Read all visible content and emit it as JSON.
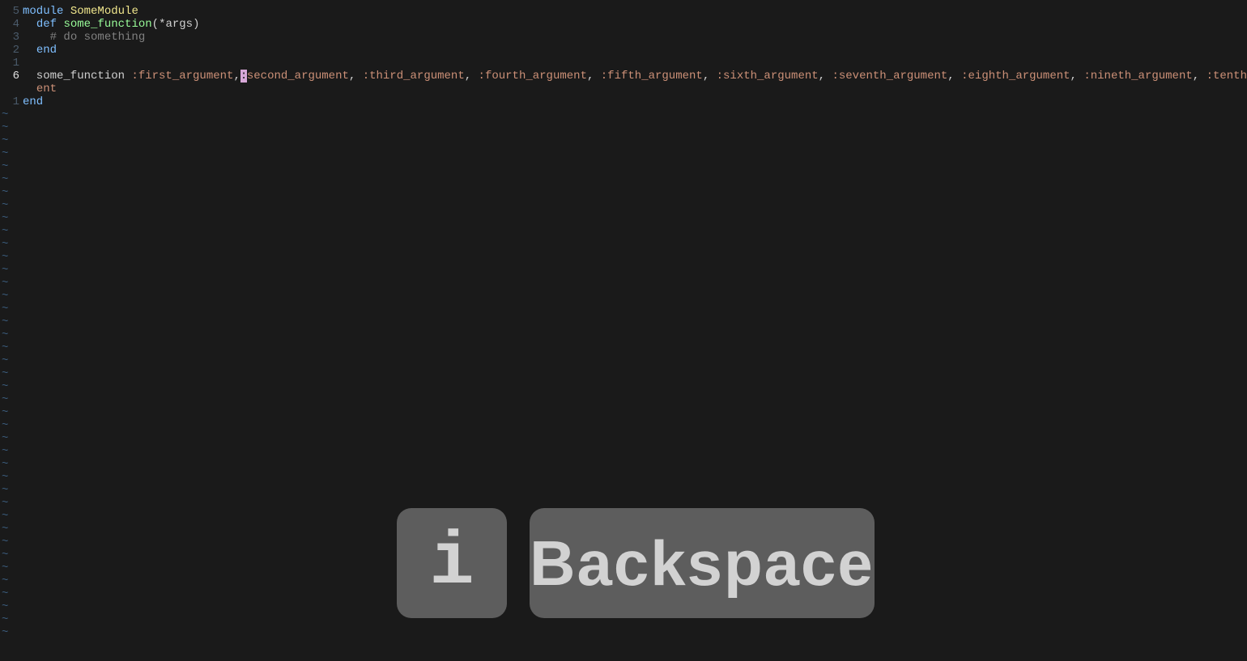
{
  "editor": {
    "cursor_line_index": 5,
    "cursor_char": ":",
    "lines": [
      {
        "num": "5",
        "current": false,
        "segments": [
          {
            "cls": "kw-module",
            "t": "module"
          },
          {
            "cls": "plain",
            "t": " "
          },
          {
            "cls": "cls-name",
            "t": "SomeModule"
          }
        ]
      },
      {
        "num": "4",
        "current": false,
        "segments": [
          {
            "cls": "plain",
            "t": "  "
          },
          {
            "cls": "kw-def",
            "t": "def"
          },
          {
            "cls": "plain",
            "t": " "
          },
          {
            "cls": "fn-name",
            "t": "some_function"
          },
          {
            "cls": "paren",
            "t": "("
          },
          {
            "cls": "args",
            "t": "*args"
          },
          {
            "cls": "paren",
            "t": ")"
          }
        ]
      },
      {
        "num": "3",
        "current": false,
        "segments": [
          {
            "cls": "plain",
            "t": "    "
          },
          {
            "cls": "comment",
            "t": "# do something"
          }
        ]
      },
      {
        "num": "2",
        "current": false,
        "segments": [
          {
            "cls": "plain",
            "t": "  "
          },
          {
            "cls": "kw-end",
            "t": "end"
          }
        ]
      },
      {
        "num": "1",
        "current": false,
        "segments": []
      },
      {
        "num": "6",
        "current": true,
        "segments": [
          {
            "cls": "plain",
            "t": "  some_function "
          },
          {
            "cls": "sym",
            "t": ":first_argument"
          },
          {
            "cls": "plain",
            "t": ","
          },
          {
            "cls": "cursor",
            "t": ":"
          },
          {
            "cls": "sym",
            "t": "second_argument"
          },
          {
            "cls": "plain",
            "t": ", "
          },
          {
            "cls": "sym",
            "t": ":third_argument"
          },
          {
            "cls": "plain",
            "t": ", "
          },
          {
            "cls": "sym",
            "t": ":fourth_argument"
          },
          {
            "cls": "plain",
            "t": ", "
          },
          {
            "cls": "sym",
            "t": ":fifth_argument"
          },
          {
            "cls": "plain",
            "t": ", "
          },
          {
            "cls": "sym",
            "t": ":sixth_argument"
          },
          {
            "cls": "plain",
            "t": ", "
          },
          {
            "cls": "sym",
            "t": ":seventh_argument"
          },
          {
            "cls": "plain",
            "t": ", "
          },
          {
            "cls": "sym",
            "t": ":eighth_argument"
          },
          {
            "cls": "plain",
            "t": ", "
          },
          {
            "cls": "sym",
            "t": ":nineth_argument"
          },
          {
            "cls": "plain",
            "t": ", "
          },
          {
            "cls": "sym",
            "t": ":tenth_argum"
          }
        ]
      },
      {
        "num": "",
        "current": false,
        "wrap": true,
        "segments": [
          {
            "cls": "plain",
            "t": "  "
          },
          {
            "cls": "sym",
            "t": "ent"
          }
        ]
      },
      {
        "num": "1",
        "current": false,
        "segments": [
          {
            "cls": "kw-end",
            "t": "end"
          }
        ]
      }
    ]
  },
  "tilde_count": 41,
  "tilde_char": "~",
  "keys": {
    "k1": "i",
    "k2": "Backspace"
  }
}
